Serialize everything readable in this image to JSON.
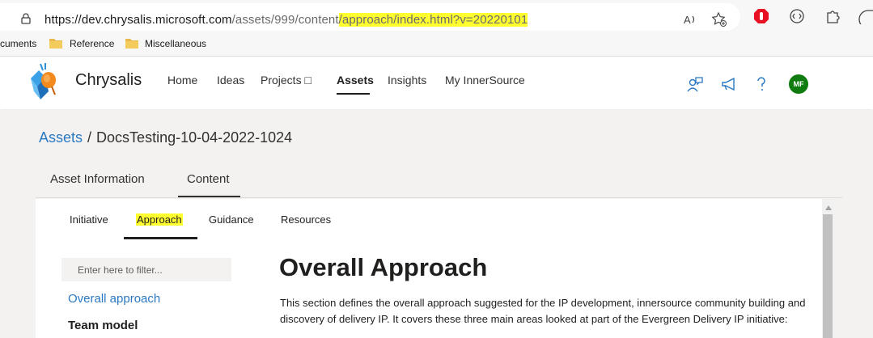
{
  "browser": {
    "url_base": "https://dev.chrysalis.microsoft.com",
    "url_dim": "/assets/999/content",
    "url_highlight": "/approach/index.html?v=20220101",
    "icons": [
      "lock-icon",
      "read-aloud-icon",
      "favorite-add-icon",
      "adblock-icon",
      "extension-icon",
      "puzzle-icon"
    ]
  },
  "favorites": {
    "items": [
      {
        "label": "cuments"
      },
      {
        "label": "Reference"
      },
      {
        "label": "Miscellaneous"
      }
    ]
  },
  "header": {
    "brand": "Chrysalis",
    "nav": [
      {
        "label": "Home"
      },
      {
        "label": "Ideas"
      },
      {
        "label": "Projects □"
      },
      {
        "label": "Assets",
        "active": true
      },
      {
        "label": "Insights"
      },
      {
        "label": "My InnerSource"
      }
    ],
    "avatar_initials": "MF",
    "avatar_color": "#107c10"
  },
  "breadcrumb": {
    "root": "Assets",
    "separator": "/",
    "current": "DocsTesting-10-04-2022-1024"
  },
  "main_tabs": [
    {
      "label": "Asset Information"
    },
    {
      "label": "Content",
      "active": true
    }
  ],
  "sub_tabs": [
    {
      "label": "Initiative"
    },
    {
      "label": "Approach",
      "active": true,
      "highlighted": true
    },
    {
      "label": "Guidance"
    },
    {
      "label": "Resources"
    }
  ],
  "sidebar": {
    "filter_placeholder": "Enter here to filter...",
    "items": [
      {
        "label": "Overall approach",
        "style": "link"
      },
      {
        "label": "Team model",
        "style": "bold"
      }
    ]
  },
  "content": {
    "title": "Overall Approach",
    "paragraph": "This section defines the overall approach suggested for the IP development, innersource community building and discovery of delivery IP. It covers these three main areas looked at part of the Evergreen Delivery IP initiative:"
  },
  "colors": {
    "link": "#2b79c2",
    "highlight": "#ffff30",
    "accent_red": "#e81123"
  }
}
